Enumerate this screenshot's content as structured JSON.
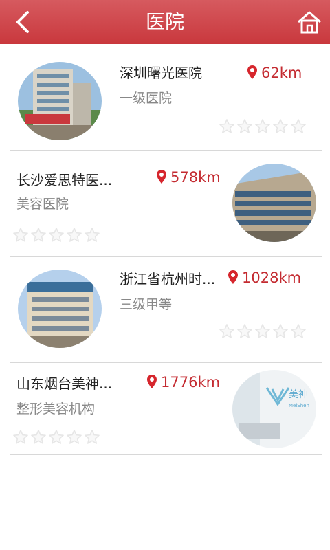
{
  "header": {
    "title": "医院"
  },
  "hospitals": [
    {
      "name": "深圳曙光医院",
      "category": "一级医院",
      "distance": "62km",
      "rating": 0
    },
    {
      "name": "长沙爱思特医...",
      "category": "美容医院",
      "distance": "578km",
      "rating": 0
    },
    {
      "name": "浙江省杭州时...",
      "category": "三级甲等",
      "distance": "1028km",
      "rating": 0
    },
    {
      "name": "山东烟台美神...",
      "category": "整形美容机构",
      "distance": "1776km",
      "rating": 0
    }
  ],
  "thumb_text": {
    "h4_sign": "美神",
    "h4_sub": "MeiShen"
  },
  "colors": {
    "header": "#c9383d",
    "accent": "#c42b31",
    "star": "#e6e6e6"
  },
  "icons": {
    "back": "chevron-left-icon",
    "home": "home-icon",
    "pin": "location-pin-icon",
    "star": "star-outline-icon"
  }
}
